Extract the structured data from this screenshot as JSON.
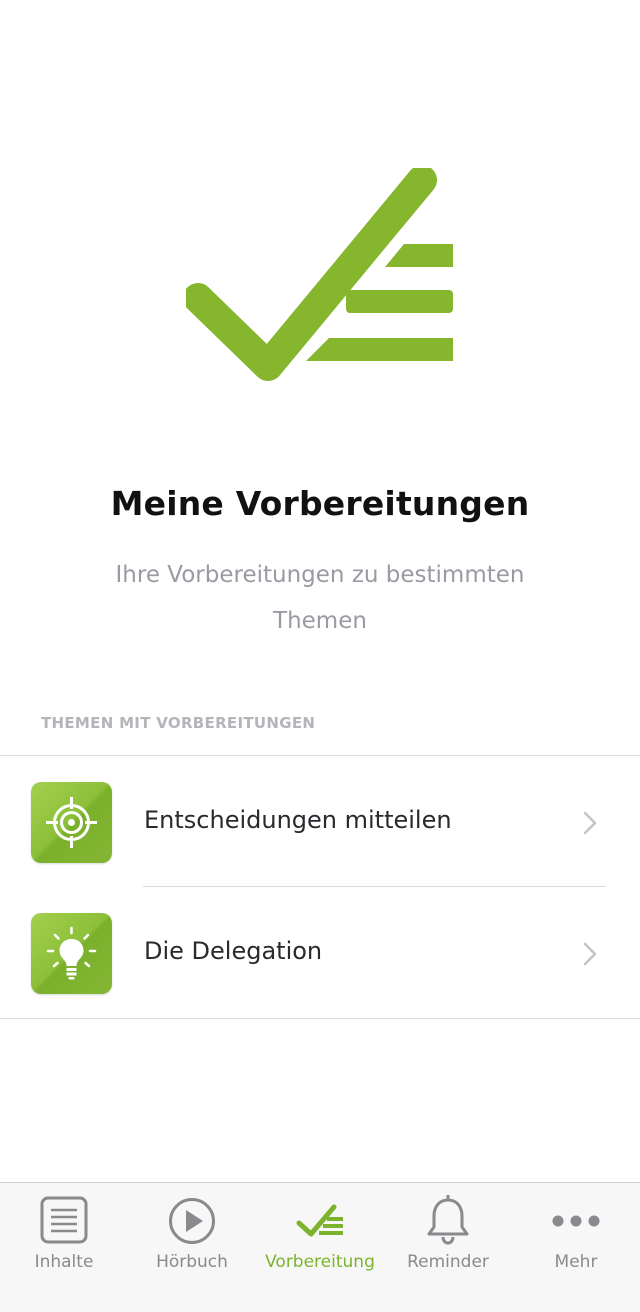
{
  "colors": {
    "accent": "#86b62e",
    "title": "#111111",
    "subtitle": "#9a9aa2",
    "section_header": "#b4b4ba",
    "inactive_tab": "#8a8a8e"
  },
  "hero": {
    "icon": "checklist-icon"
  },
  "header": {
    "title": "Meine Vorbereitungen",
    "subtitle": "Ihre Vorbereitungen zu bestimmten Themen"
  },
  "section": {
    "title": "THEMEN MIT VORBEREITUNGEN"
  },
  "topics": [
    {
      "label": "Entscheidungen mitteilen",
      "icon": "target-icon"
    },
    {
      "label": "Die Delegation",
      "icon": "lightbulb-icon"
    }
  ],
  "tabbar": {
    "active": "Vorbereitung",
    "items": [
      {
        "label": "Inhalte",
        "icon": "document-icon"
      },
      {
        "label": "Hörbuch",
        "icon": "play-icon"
      },
      {
        "label": "Vorbereitung",
        "icon": "checklist-icon"
      },
      {
        "label": "Reminder",
        "icon": "bell-icon"
      },
      {
        "label": "Mehr",
        "icon": "more-icon"
      }
    ]
  }
}
